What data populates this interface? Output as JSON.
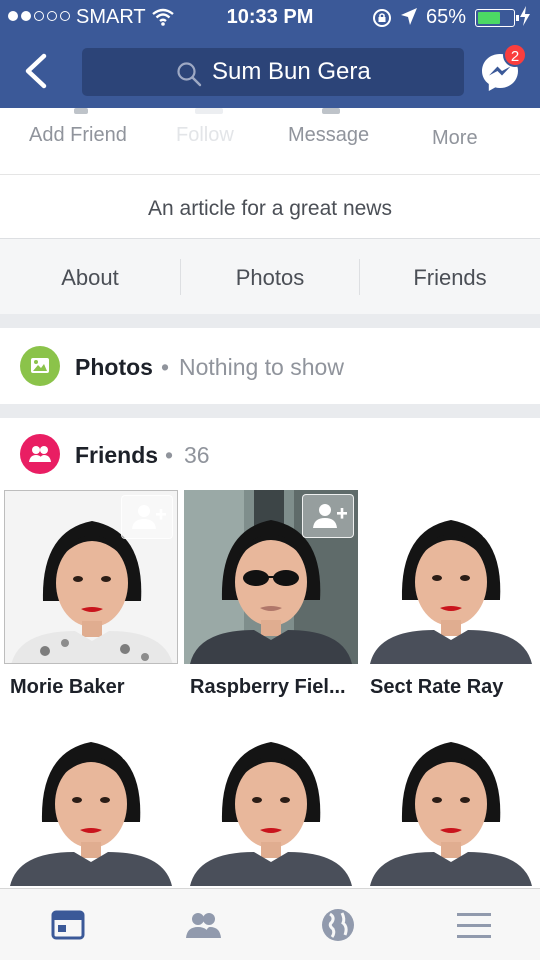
{
  "status_bar": {
    "carrier": "SMART",
    "time": "10:33 PM",
    "battery": "65%",
    "battery_level": 0.65,
    "signal_bars_filled": 2,
    "signal_bars_total": 5
  },
  "nav": {
    "search_text": "Sum Bun Gera",
    "messenger_badge": "2"
  },
  "actions": {
    "add_friend": "Add Friend",
    "follow": "Follow",
    "message": "Message",
    "more": "More"
  },
  "article": "An article for a great news",
  "tabs": [
    "About",
    "Photos",
    "Friends"
  ],
  "photos_section": {
    "title": "Photos",
    "subtitle": "Nothing to show"
  },
  "friends_section": {
    "title": "Friends",
    "count": "36",
    "friends": [
      {
        "name": "Morie Baker"
      },
      {
        "name": "Raspberry Fiel..."
      },
      {
        "name": "Sect Rate Ray"
      },
      {
        "name": ""
      },
      {
        "name": ""
      },
      {
        "name": ""
      }
    ]
  },
  "colors": {
    "brand": "#3b5998",
    "photos_icon": "#8bc34a",
    "friends_icon": "#e91e63",
    "badge": "#fa3e3e",
    "battery": "#4cd964"
  },
  "icons": {
    "tab_bar": [
      "news-feed-icon",
      "friends-icon",
      "globe-icon",
      "menu-icon"
    ]
  }
}
